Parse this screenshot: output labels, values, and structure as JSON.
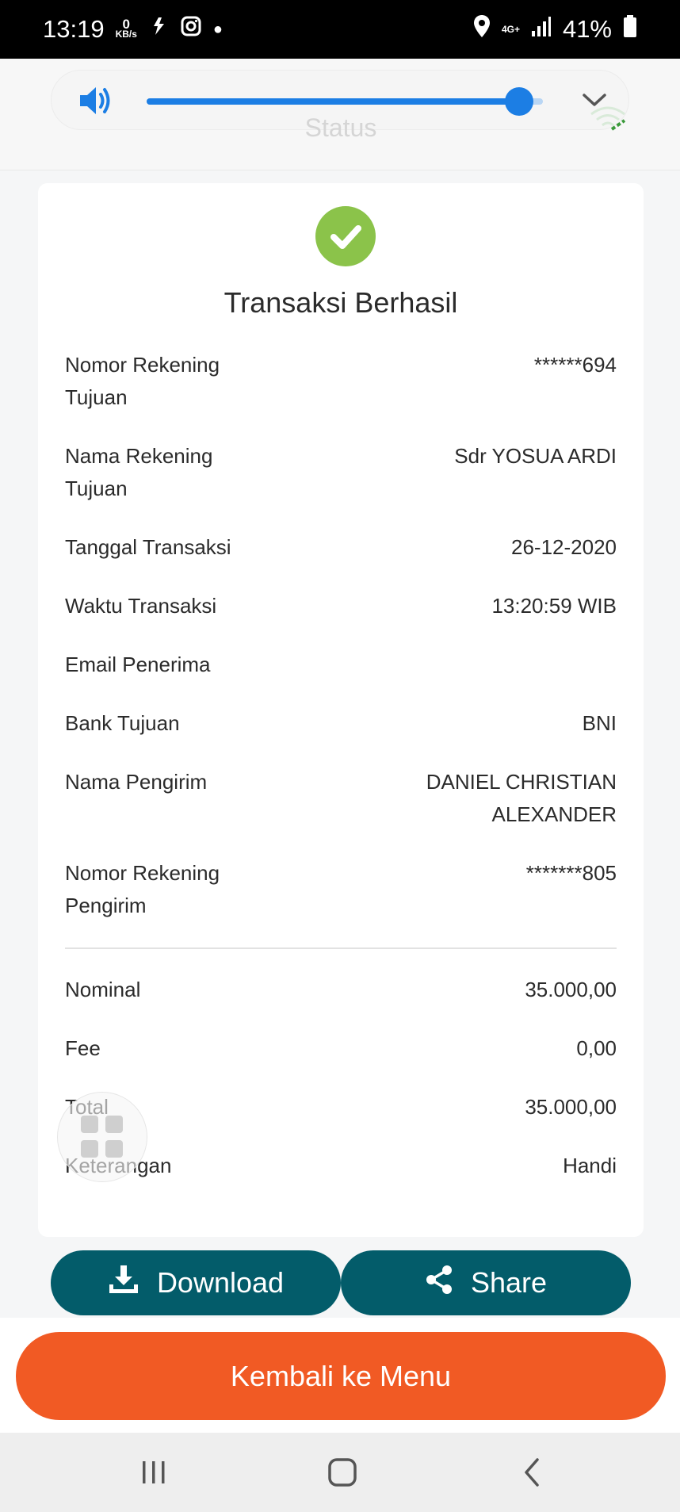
{
  "status_bar": {
    "time": "13:19",
    "net_speed_value": "0",
    "net_speed_unit": "KB/s",
    "network": "4G+",
    "battery": "41%"
  },
  "volume": {
    "level": 0.94,
    "accent_color": "#1c7ee4",
    "overlay_label": "Status"
  },
  "receipt": {
    "title": "Transaksi Berhasil",
    "rows": [
      {
        "label": "Nomor Rekening Tujuan",
        "value": "******694"
      },
      {
        "label": "Nama Rekening Tujuan",
        "value": "Sdr YOSUA ARDI"
      },
      {
        "label": "Tanggal Transaksi",
        "value": "26-12-2020"
      },
      {
        "label": "Waktu Transaksi",
        "value": "13:20:59 WIB"
      },
      {
        "label": "Email Penerima",
        "value": ""
      },
      {
        "label": "Bank Tujuan",
        "value": "BNI"
      },
      {
        "label": "Nama Pengirim",
        "value": "DANIEL CHRISTIAN ALEXANDER"
      },
      {
        "label": "Nomor Rekening Pengirim",
        "value": "*******805"
      }
    ],
    "summary": [
      {
        "label": "Nominal",
        "value": "35.000,00"
      },
      {
        "label": "Fee",
        "value": "0,00"
      },
      {
        "label": "Total",
        "value": "35.000,00"
      },
      {
        "label": "Keterangan",
        "value": "Handi"
      }
    ],
    "success_color": "#8bc34a"
  },
  "actions": {
    "download_label": "Download",
    "share_label": "Share",
    "menu_label": "Kembali ke Menu",
    "primary_color": "#035c6a",
    "menu_color": "#f15a24"
  },
  "icons": [
    "location-icon",
    "signal-icon",
    "battery-icon",
    "volume-icon",
    "chevron-down-icon",
    "check-icon",
    "download-icon",
    "share-icon",
    "grid-icon",
    "recents-icon",
    "home-icon",
    "back-icon"
  ]
}
